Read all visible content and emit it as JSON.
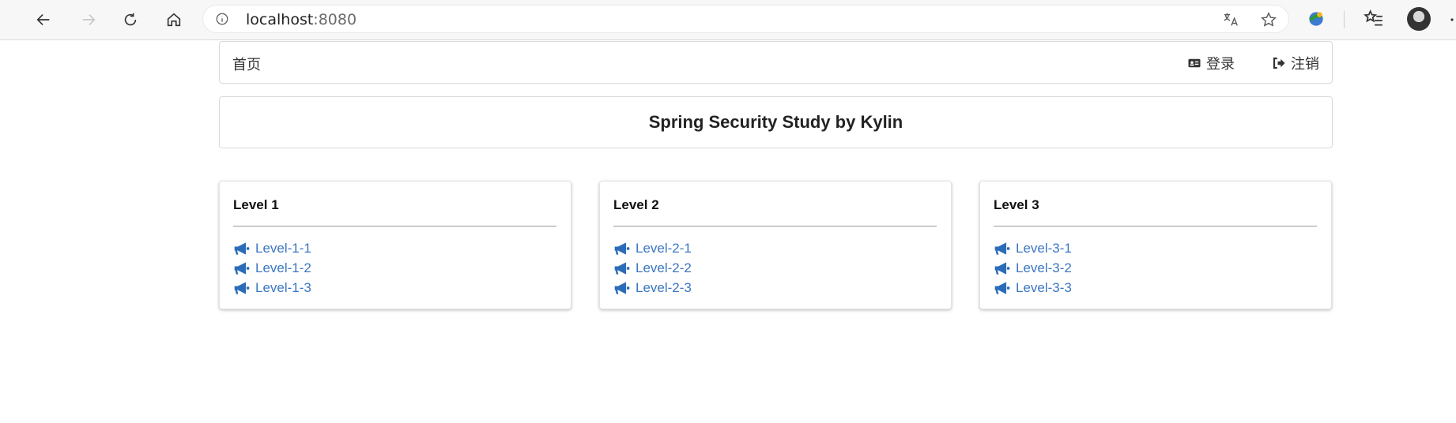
{
  "browser": {
    "url_host": "localhost",
    "url_port": ":8080",
    "icons": {
      "back": "back-arrow-icon",
      "forward": "forward-arrow-icon",
      "reload": "reload-icon",
      "home": "home-icon",
      "info": "info-icon",
      "translate": "translate-icon",
      "favorite": "star-icon",
      "extension": "extension-icon",
      "favorites": "favorites-list-icon"
    }
  },
  "topbar": {
    "home_label": "首页",
    "login_label": "登录",
    "logout_label": "注销"
  },
  "header": {
    "title": "Spring Security Study by Kylin"
  },
  "cards": [
    {
      "title": "Level 1",
      "links": [
        "Level-1-1",
        "Level-1-2",
        "Level-1-3"
      ]
    },
    {
      "title": "Level 2",
      "links": [
        "Level-2-1",
        "Level-2-2",
        "Level-2-3"
      ]
    },
    {
      "title": "Level 3",
      "links": [
        "Level-3-1",
        "Level-3-2",
        "Level-3-3"
      ]
    }
  ],
  "colors": {
    "link": "#3a76c2",
    "border": "#d9d9d9"
  }
}
